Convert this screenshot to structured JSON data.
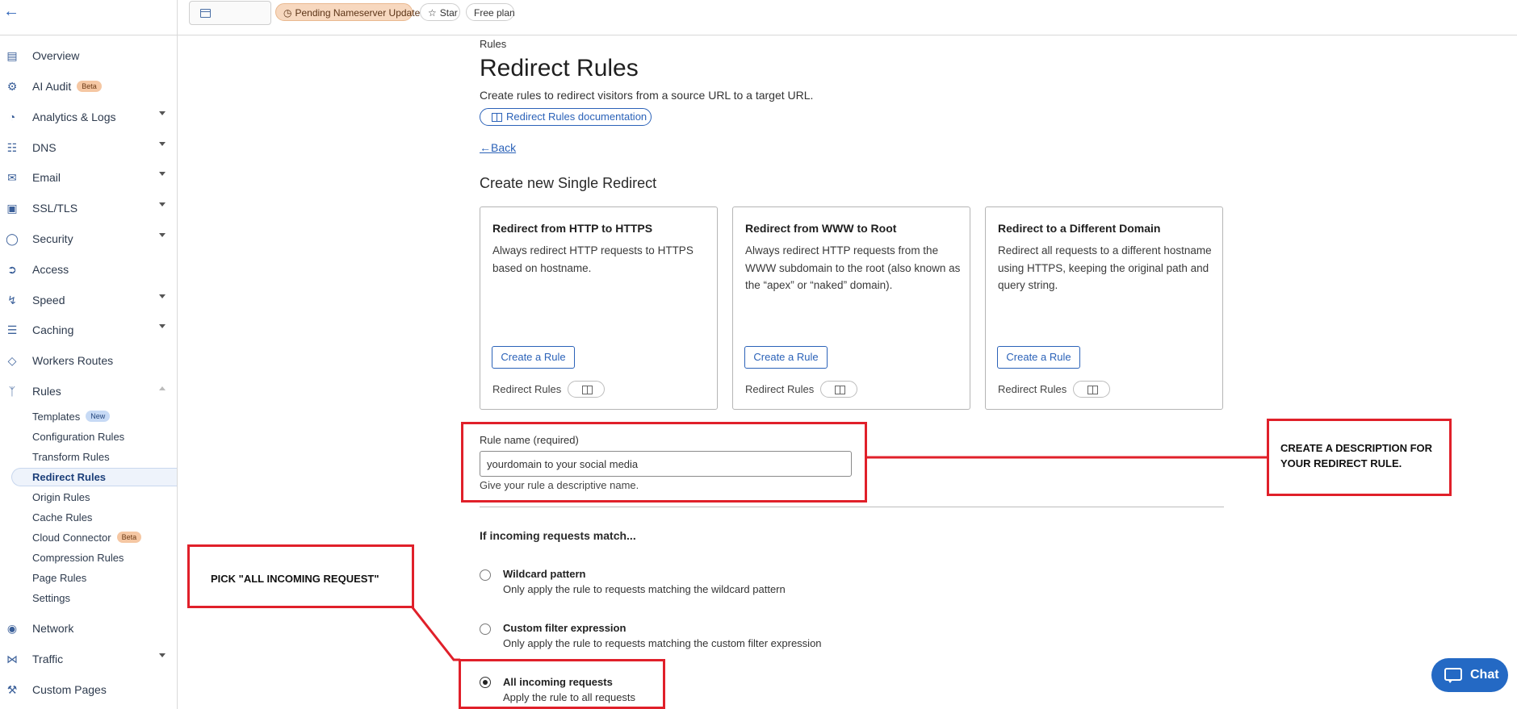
{
  "topbar": {
    "pending_label": "Pending Nameserver Update",
    "star_label": "Star",
    "plan_label": "Free plan"
  },
  "sidebar": {
    "items": [
      {
        "label": "Overview",
        "icon": "document-icon"
      },
      {
        "label": "AI Audit",
        "icon": "robot-icon",
        "badge": "Beta"
      },
      {
        "label": "Analytics & Logs",
        "icon": "clock-chart-icon"
      },
      {
        "label": "DNS",
        "icon": "network-tree-icon"
      },
      {
        "label": "Email",
        "icon": "envelope-icon"
      },
      {
        "label": "SSL/TLS",
        "icon": "lock-icon"
      },
      {
        "label": "Security",
        "icon": "shield-icon"
      },
      {
        "label": "Access",
        "icon": "login-icon"
      },
      {
        "label": "Speed",
        "icon": "lightning-icon"
      },
      {
        "label": "Caching",
        "icon": "server-stack-icon"
      },
      {
        "label": "Workers Routes",
        "icon": "code-diamond-icon"
      },
      {
        "label": "Rules",
        "icon": "fork-icon"
      }
    ],
    "rules_sub": [
      {
        "label": "Templates",
        "badge": "New"
      },
      {
        "label": "Configuration Rules"
      },
      {
        "label": "Transform Rules"
      },
      {
        "label": "Redirect Rules"
      },
      {
        "label": "Origin Rules"
      },
      {
        "label": "Cache Rules"
      },
      {
        "label": "Cloud Connector",
        "badge": "Beta"
      },
      {
        "label": "Compression Rules"
      },
      {
        "label": "Page Rules"
      },
      {
        "label": "Settings"
      }
    ],
    "bottom_items": [
      {
        "label": "Network",
        "icon": "pin-icon"
      },
      {
        "label": "Traffic",
        "icon": "share-nodes-icon"
      },
      {
        "label": "Custom Pages",
        "icon": "wrench-icon"
      }
    ]
  },
  "main": {
    "breadcrumb": "Rules",
    "title": "Redirect Rules",
    "description": "Create rules to redirect visitors from a source URL to a target URL.",
    "doc_link": "Redirect Rules documentation",
    "back_label": "Back",
    "section_title": "Create new Single Redirect",
    "cards": [
      {
        "title": "Redirect from HTTP to HTTPS",
        "description": "Always redirect HTTP requests to HTTPS based on hostname.",
        "button": "Create a Rule",
        "footer": "Redirect Rules"
      },
      {
        "title": "Redirect from WWW to Root",
        "description": "Always redirect HTTP requests from the WWW subdomain to the root (also known as the “apex” or “naked” domain).",
        "button": "Create a Rule",
        "footer": "Redirect Rules"
      },
      {
        "title": "Redirect to a Different Domain",
        "description": "Redirect all requests to a different hostname using HTTPS, keeping the original path and query string.",
        "button": "Create a Rule",
        "footer": "Redirect Rules"
      }
    ],
    "rule_name": {
      "label": "Rule name (required)",
      "value": "yourdomain to your social media",
      "help": "Give your rule a descriptive name."
    },
    "match_title": "If incoming requests match...",
    "options": [
      {
        "title": "Wildcard pattern",
        "description": "Only apply the rule to requests matching the wildcard pattern",
        "checked": false
      },
      {
        "title": "Custom filter expression",
        "description": "Only apply the rule to requests matching the custom filter expression",
        "checked": false
      },
      {
        "title": "All incoming requests",
        "description": "Apply the rule to all requests",
        "checked": true
      }
    ]
  },
  "annotations": {
    "right_note": "CREATE A DESCRIPTION FOR YOUR REDIRECT RULE.",
    "left_note": "PICK \"ALL INCOMING REQUEST\"",
    "color": "#e0202a"
  },
  "chat": {
    "label": "Chat"
  }
}
